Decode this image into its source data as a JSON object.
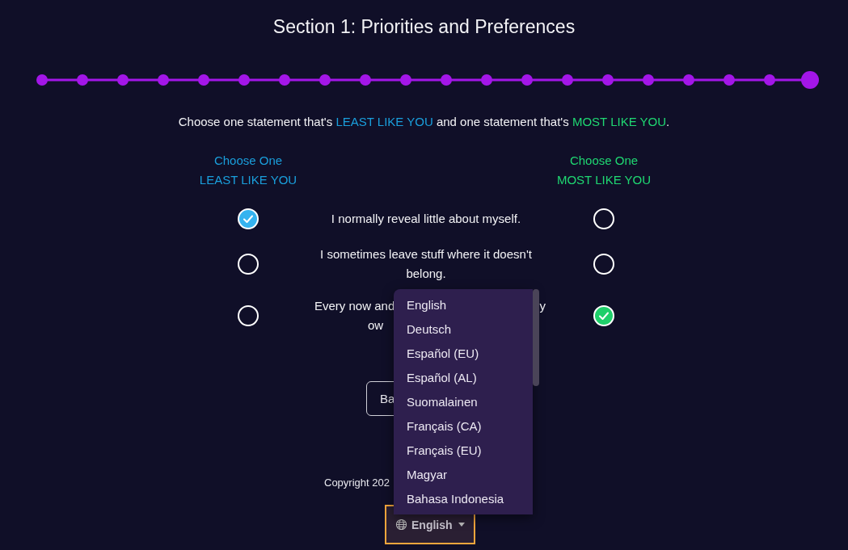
{
  "title": "Section 1: Priorities and Preferences",
  "progress": [
    {
      "current": false
    },
    {
      "current": false
    },
    {
      "current": false
    },
    {
      "current": false
    },
    {
      "current": false
    },
    {
      "current": false
    },
    {
      "current": false
    },
    {
      "current": false
    },
    {
      "current": false
    },
    {
      "current": false
    },
    {
      "current": false
    },
    {
      "current": false
    },
    {
      "current": false
    },
    {
      "current": false
    },
    {
      "current": false
    },
    {
      "current": false
    },
    {
      "current": false
    },
    {
      "current": false
    },
    {
      "current": false
    },
    {
      "current": true
    }
  ],
  "instruction": {
    "before": "Choose one statement that's ",
    "least": "LEAST LIKE YOU",
    "middle": " and one statement that's ",
    "most": "MOST LIKE YOU",
    "after": "."
  },
  "least_header": [
    "Choose One",
    "LEAST LIKE YOU"
  ],
  "most_header": [
    "Choose One",
    "MOST LIKE YOU"
  ],
  "statements": [
    {
      "text": "I normally reveal little about myself.",
      "least_selected": true,
      "most_selected": false
    },
    {
      "text": "I sometimes leave stuff where it doesn't belong.",
      "least_selected": false,
      "most_selected": false
    },
    {
      "fragments": [
        "Every now and",
        "y",
        "ow"
      ],
      "least_selected": false,
      "most_selected": true
    }
  ],
  "back_button": "Ba",
  "copyright": "Copyright 202",
  "language_menu": {
    "options": [
      "English",
      "Deutsch",
      "Español (EU)",
      "Español (AL)",
      "Suomalainen",
      "Français (CA)",
      "Français (EU)",
      "Magyar",
      "Bahasa Indonesia"
    ]
  },
  "language_button": "English"
}
